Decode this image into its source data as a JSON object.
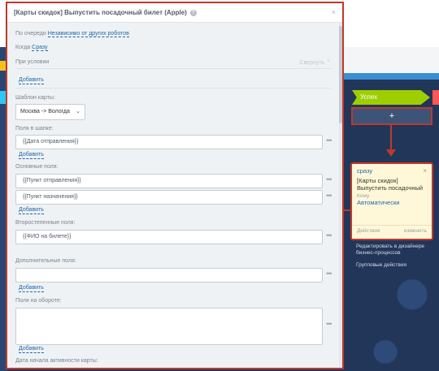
{
  "dialog": {
    "title": "[Карты скидок] Выпустить посадочный билет (Apple)",
    "close": "×",
    "queue_label": "По очереди",
    "queue_value": "Независимо от других роботов",
    "when_label": "Когда",
    "when_value": "Сразу",
    "condition_label": "При условии",
    "collapse_label": "Свернуть",
    "add_label": "Добавить",
    "template_label": "Шаблон карты:",
    "template_value": "Москва -> Вологда",
    "header_fields_label": "Поля в шапке:",
    "header_fields": [
      "{{Дата отправления}}"
    ],
    "main_fields_label": "Основные поля:",
    "main_fields": [
      "{{Пункт отправления}}",
      "{{Пункт назначения}}"
    ],
    "secondary_fields_label": "Второстепенные поля:",
    "secondary_fields": [
      "{{ФИО на билете}}"
    ],
    "additional_fields_label": "Дополнительные поля:",
    "back_fields_label": "Поля на обороте:",
    "active_date_label": "Дата начала активности карты:"
  },
  "pipeline": {
    "stage_success": "Успех",
    "plus": "+"
  },
  "robot_card": {
    "when": "сразу",
    "title": "[Карты скидок] Выпустить посадочный",
    "who_label": "Кому",
    "who": "Автоматически",
    "settings": "Действия",
    "edit": "изменить",
    "close": "×"
  },
  "side_links": {
    "designer": "Редактировать в дизайнере бизнес-процессов",
    "group_actions": "Групповые действия"
  },
  "colors": {
    "accent_red": "#c0392b",
    "link_blue": "#2067b0",
    "success_green": "#9dcf00"
  }
}
